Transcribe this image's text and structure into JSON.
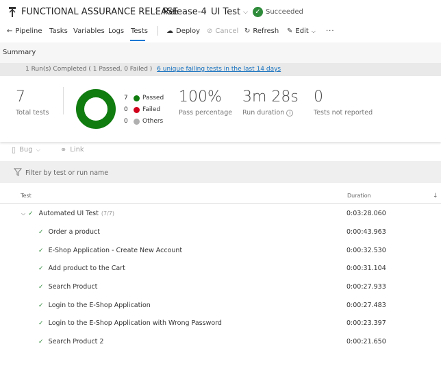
{
  "header": {
    "release_name": "FUNCTIONAL ASSURANCE RELEASE",
    "release": "Release-4",
    "stage": "UI Test",
    "status": "Succeeded"
  },
  "toolbar": {
    "pipeline": "Pipeline",
    "tasks": "Tasks",
    "variables": "Variables",
    "logs": "Logs",
    "tests": "Tests",
    "deploy": "Deploy",
    "cancel": "Cancel",
    "refresh": "Refresh",
    "edit": "Edit",
    "more": "···"
  },
  "summary": {
    "title": "Summary",
    "runs_text": "1 Run(s) Completed ( 1 Passed, 0 Failed )",
    "failing_link": "6 unique failing tests in the last 14 days",
    "total_tests": "7",
    "total_label": "Total tests",
    "passed_count": "7",
    "passed_label": "Passed",
    "failed_count": "0",
    "failed_label": "Failed",
    "others_count": "0",
    "others_label": "Others",
    "pass_percentage": "100%",
    "pass_percentage_label": "Pass percentage",
    "run_duration": "3m 28s",
    "run_duration_label": "Run duration",
    "not_reported": "0",
    "not_reported_label": "Tests not reported"
  },
  "actions": {
    "bug": "Bug",
    "link": "Link"
  },
  "filter": {
    "placeholder": "Filter by test or run name"
  },
  "table": {
    "col_test": "Test",
    "col_duration": "Duration",
    "group": {
      "name": "Automated UI Test",
      "count": "(7/7)",
      "duration": "0:03:28.060"
    },
    "rows": [
      {
        "name": "Order a product",
        "duration": "0:00:43.963"
      },
      {
        "name": "E-Shop Application - Create New Account",
        "duration": "0:00:32.530"
      },
      {
        "name": "Add product to the Cart",
        "duration": "0:00:31.104"
      },
      {
        "name": "Search Product",
        "duration": "0:00:27.933"
      },
      {
        "name": "Login to the E-Shop Application",
        "duration": "0:00:27.483"
      },
      {
        "name": "Login to the E-Shop Application with Wrong Password",
        "duration": "0:00:23.397"
      },
      {
        "name": "Search Product 2",
        "duration": "0:00:21.650"
      }
    ]
  },
  "colors": {
    "passed": "#107c10",
    "failed": "#d0021b",
    "others": "#b0b0b0",
    "accent": "#0078d4"
  }
}
